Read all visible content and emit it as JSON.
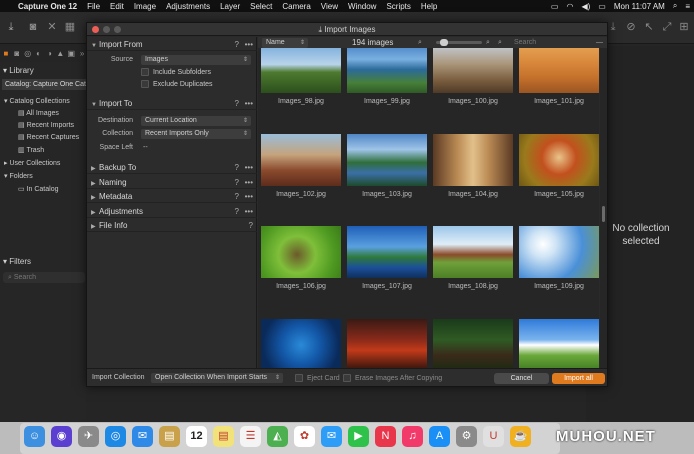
{
  "menubar": {
    "apple": "",
    "items": [
      "Capture One 12",
      "File",
      "Edit",
      "Image",
      "Adjustments",
      "Layer",
      "Select",
      "Camera",
      "View",
      "Window",
      "Scripts",
      "Help"
    ],
    "clock": "Mon 11:07 AM"
  },
  "left_panel": {
    "library_header": "Library",
    "catalog": "Catalog: Capture One Catalog",
    "catalog_collections": "Catalog Collections",
    "all_images": "All Images",
    "recent_imports": "Recent Imports",
    "recent_captures": "Recent Captures",
    "trash": "Trash",
    "user_collections": "User Collections",
    "folders": "Folders",
    "in_catalog": "In Catalog",
    "filters_header": "Filters",
    "search_placeholder": "Search"
  },
  "right_panel": {
    "no_collection": "No collection selected"
  },
  "dialog": {
    "title": "Import Images",
    "import_from": {
      "title": "Import From",
      "source_label": "Source",
      "source_value": "Images",
      "include_subfolders": "Include Subfolders",
      "exclude_duplicates": "Exclude Duplicates"
    },
    "import_to": {
      "title": "Import To",
      "destination_label": "Destination",
      "destination_value": "Current Location",
      "collection_label": "Collection",
      "collection_value": "Recent Imports Only",
      "space_left_label": "Space Left",
      "space_left_value": "--"
    },
    "sections": [
      "Backup To",
      "Naming",
      "Metadata",
      "Adjustments",
      "File Info"
    ],
    "help": "?",
    "more": "•••",
    "grid_header": {
      "sort_value": "Name",
      "count": "194 images",
      "search_placeholder": "Search"
    },
    "images": [
      "Images_98.jpg",
      "Images_99.jpg",
      "Images_100.jpg",
      "Images_101.jpg",
      "Images_102.jpg",
      "Images_103.jpg",
      "Images_104.jpg",
      "Images_105.jpg",
      "Images_106.jpg",
      "Images_107.jpg",
      "Images_108.jpg",
      "Images_109.jpg",
      "",
      "",
      "",
      ""
    ],
    "footer": {
      "import_collection_label": "Import Collection",
      "import_collection_value": "Open Collection When Import Starts",
      "eject_card": "Eject Card",
      "erase_images": "Erase Images After Copying",
      "cancel": "Cancel",
      "import_all": "Import all"
    }
  },
  "dock": {
    "icons": [
      "finder-icon",
      "siri-icon",
      "launchpad-icon",
      "safari-icon",
      "mail-icon",
      "notes-icon",
      "calendar-icon",
      "stickies-icon",
      "reminders-icon",
      "maps-icon",
      "photos-icon",
      "messages-icon",
      "facetime-icon",
      "news-icon",
      "music-icon",
      "appstore-icon",
      "settings-icon",
      "magnet-icon",
      "capture-one-icon"
    ],
    "calendar_day": "12"
  },
  "watermark": "MUHOU.NET",
  "colors": {
    "accent": "#e07a1f",
    "panel": "#2a2a2a",
    "dark": "#1e1e1e"
  }
}
